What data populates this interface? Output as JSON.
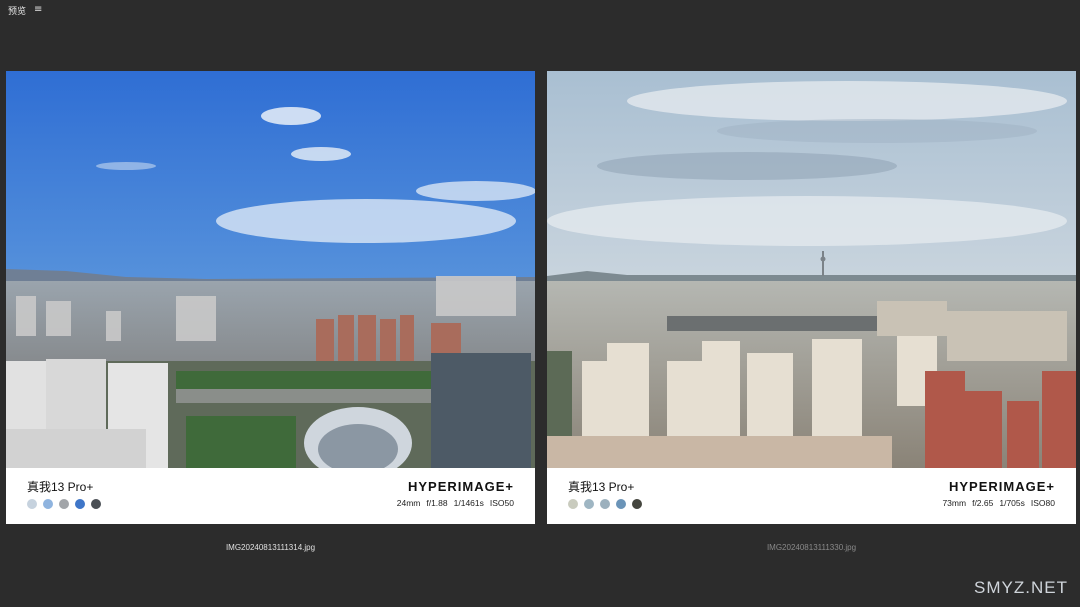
{
  "app": {
    "title": "预览",
    "menu_icon": "hamburger-menu-icon"
  },
  "images": [
    {
      "model": "真我13 Pro+",
      "brand": "HYPERIMAGE+",
      "specs": [
        "24mm",
        "f/1.88",
        "1/1461s",
        "ISO50"
      ],
      "filename": "IMG20240813111314.jpg",
      "palette": [
        "#c6d2de",
        "#8fb4df",
        "#a2a5a9",
        "#3f76c8",
        "#4a4f55"
      ]
    },
    {
      "model": "真我13 Pro+",
      "brand": "HYPERIMAGE+",
      "specs": [
        "73mm",
        "f/2.65",
        "1/705s",
        "ISO80"
      ],
      "filename": "IMG20240813111330.jpg",
      "palette": [
        "#c9cbbe",
        "#9fb6c3",
        "#9cb0bd",
        "#6b94b8",
        "#45463f"
      ]
    }
  ],
  "watermark": "SMYZ.NET"
}
